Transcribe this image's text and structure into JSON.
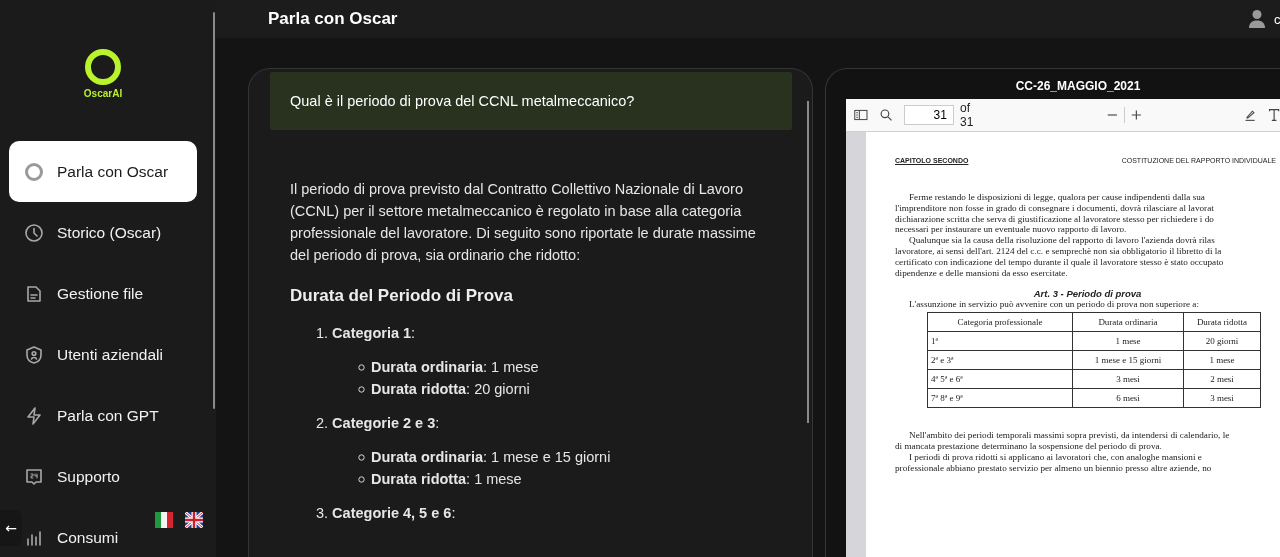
{
  "sidebar": {
    "logo_text": "OscarAI",
    "items": [
      {
        "label": "Parla con Oscar",
        "selected": true
      },
      {
        "label": "Storico (Oscar)",
        "selected": false
      },
      {
        "label": "Gestione file",
        "selected": false
      },
      {
        "label": "Utenti aziendali",
        "selected": false
      },
      {
        "label": "Parla con GPT",
        "selected": false
      },
      {
        "label": "Supporto",
        "selected": false
      },
      {
        "label": "Consumi",
        "selected": false
      }
    ],
    "back_button": "←"
  },
  "header": {
    "title": "Parla con Oscar",
    "user_name": "c"
  },
  "chat": {
    "question": "Qual è il periodo di prova del CCNL metalmeccanico?",
    "answer_intro": "Il periodo di prova previsto dal Contratto Collettivo Nazionale di Lavoro (CCNL) per il settore metalmeccanico è regolato in base alla categoria professionale del lavoratore. Di seguito sono riportate le durate massime del periodo di prova, sia ordinario che ridotto:",
    "answer_heading": "Durata del Periodo di Prova",
    "categories": [
      {
        "number": "1.",
        "title": "**Categoria 1**:",
        "items": [
          "**Durata ordinaria**: 1 mese",
          "**Durata ridotta**: 20 giorni"
        ]
      },
      {
        "number": "2.",
        "title": "**Categorie 2 e 3**:",
        "items": [
          "**Durata ordinaria**: 1 mese e 15 giorni",
          "**Durata ridotta**: 1 mese"
        ]
      },
      {
        "number": "3.",
        "title": "**Categorie 4, 5 e 6**:"
      }
    ]
  },
  "pdf": {
    "title": "CC-26_MAGGIO_2021",
    "page": "31",
    "page_total": "of 31",
    "running_head_left": "CAPITOLO SECONDO",
    "running_head_right": "COSTITUZIONE DEL RAPPORTO INDIVIDUALE",
    "paragraph_1": [
      "Ferme restando le disposizioni di legge, qualora per cause indipendenti dalla sua",
      "l'imprenditore non fosse in grado di consegnare i documenti, dovrà rilasciare al lavorat",
      "dichiarazione scritta che serva di giustificazione al lavoratore stesso per richiedere i do",
      "necessari per instaurare un eventuale nuovo rapporto di lavoro."
    ],
    "paragraph_2": [
      "Qualunque sia la causa della risoluzione del rapporto di lavoro l'azienda dovrà rilas",
      "lavoratore, ai sensi dell'art. 2124 del c.c. e semprechè non sia obbligatorio il libretto di la",
      "certificato con indicazione del tempo durante il quale il lavoratore stesso è stato occupato",
      "dipendenze e delle mansioni da esso esercitate."
    ],
    "article_title": "Art. 3 - Periodo di prova",
    "article_intro": "L'assunzione in servizio può avvenire con un periodo di prova non superiore a:",
    "table": {
      "columns": [
        "Categoria professionale",
        "Durata ordinaria",
        "Durata ridotta"
      ],
      "rows": [
        [
          "1ª",
          "1 mese",
          "20 giorni"
        ],
        [
          "2ª e 3ª",
          "1 mese e 15 giorni",
          "1 mese"
        ],
        [
          "4ª 5ª e 6ª",
          "3 mesi",
          "2 mesi"
        ],
        [
          "7ª 8ª e 9ª",
          "6 mesi",
          "3 mesi"
        ]
      ]
    },
    "paragraph_3": [
      "Nell'ambito dei periodi temporali massimi sopra previsti, da intendersi di calendario, le",
      "di mancata prestazione determinano la sospensione del periodo di prova."
    ],
    "paragraph_4": [
      "I periodi di prova ridotti si applicano ai lavoratori che, con analoghe mansioni e",
      "professionale abbiano prestato servizio per almeno un biennio presso altre aziende, no"
    ]
  }
}
